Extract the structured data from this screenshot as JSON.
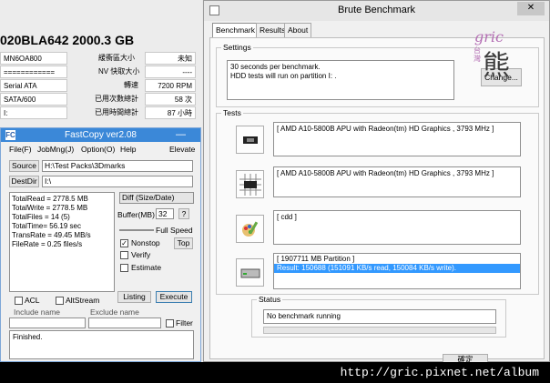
{
  "cdi": {
    "model": "020BLA642  2000.3 GB",
    "rows": [
      {
        "left": "MN6OA800",
        "right_label": "緩衝區大小",
        "right_val": "未知"
      },
      {
        "left": "============",
        "right_label": "NV 快取大小",
        "right_val": "----"
      },
      {
        "left": "Serial ATA",
        "right_label": "轉速",
        "right_val": "7200 RPM"
      },
      {
        "left": "SATA/600",
        "right_label": "已用次數總計",
        "right_val": "58 次"
      },
      {
        "left": "I:",
        "right_label": "已用時間總計",
        "right_val": "87 小時"
      }
    ]
  },
  "brute": {
    "title": "Brute Benchmark",
    "close": "✕",
    "minimize": "—",
    "tabs": [
      "Benchmark",
      "Results",
      "About"
    ],
    "settings_label": "Settings",
    "settings_lines": [
      "30 seconds per benchmark.",
      "HDD tests will run on partition I: ."
    ],
    "change_button": "Change...",
    "watermark_top": "gric",
    "watermark_side": "台灣",
    "watermark_big": "熊",
    "tests_label": "Tests",
    "tests": [
      {
        "icon": "cpu-chip-icon",
        "lines": [
          "[ AMD A10-5800B APU with Radeon(tm) HD Graphics  , 3793 MHz ]"
        ]
      },
      {
        "icon": "cpu-grid-icon",
        "lines": [
          "[ AMD A10-5800B APU with Radeon(tm) HD Graphics  , 3793 MHz ]"
        ]
      },
      {
        "icon": "paint-palette-icon",
        "lines": [
          "[ cdd ]"
        ]
      },
      {
        "icon": "hard-drive-icon",
        "lines": [
          "[ 1907711 MB Partition ]",
          "Result: 150688 (151091 KB/s read, 150084 KB/s  write)."
        ]
      }
    ],
    "status_label": "Status",
    "status_text": "No benchmark running",
    "bottom_button_partial": "確定"
  },
  "fastcopy": {
    "title": "FastCopy ver2.08",
    "menu": [
      "File(F)",
      "JobMng(J)",
      "Option(O)",
      "Help"
    ],
    "elevate": "Elevate",
    "source_button": "Source",
    "source_value": "H:\\Test Packs\\3Dmarks",
    "destdir_button": "DestDir",
    "destdir_value": "I:\\",
    "stats": [
      "TotalRead = 2778.5 MB",
      "TotalWrite = 2778.5 MB",
      "TotalFiles = 14 (5)",
      "TotalTime= 56.19 sec",
      "TransRate = 49.45 MB/s",
      "FileRate  = 0.25 files/s"
    ],
    "mode_select": "Diff (Size/Date)",
    "buffer_label": "Buffer(MB)",
    "buffer_value": "32",
    "help_q": "?",
    "full_speed": "Full Speed",
    "nonstop_label": "Nonstop",
    "top_button": "Top",
    "verify_label": "Verify",
    "estimate_label": "Estimate",
    "listing_button": "Listing",
    "execute_button": "Execute",
    "acl_label": "ACL",
    "altstream_label": "AltStream",
    "include_label": "Include name",
    "exclude_label": "Exclude name",
    "filter_label": "Filter",
    "log_text": "Finished."
  },
  "footer_url": "http://gric.pixnet.net/album"
}
